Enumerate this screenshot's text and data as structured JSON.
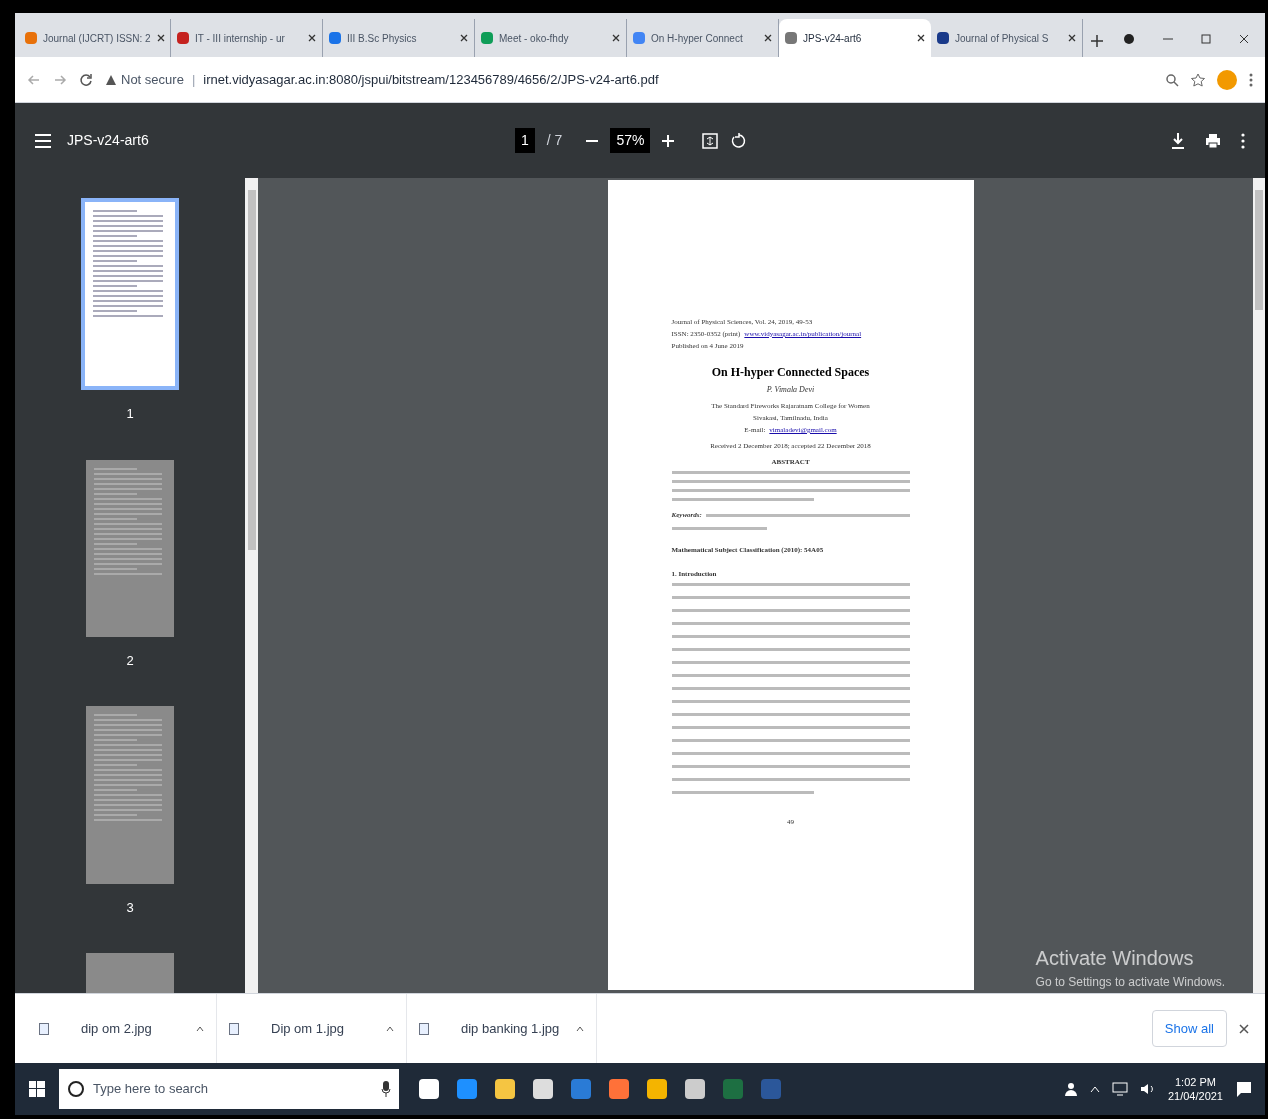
{
  "tabs": [
    {
      "title": "Journal (IJCRT) ISSN: 2",
      "selected": false
    },
    {
      "title": "IT - III internship - ur",
      "selected": false
    },
    {
      "title": "III B.Sc Physics",
      "selected": false
    },
    {
      "title": "Meet - oko-fhdy",
      "selected": false
    },
    {
      "title": "On H-hyper Connect",
      "selected": false
    },
    {
      "title": "JPS-v24-art6",
      "selected": true
    },
    {
      "title": "Journal of Physical S",
      "selected": false
    }
  ],
  "address_bar": {
    "security": "Not secure",
    "separator": "|",
    "url": "irnet.vidyasagar.ac.in:8080/jspui/bitstream/123456789/4656/2/JPS-v24-art6.pdf"
  },
  "pdf_toolbar": {
    "title": "JPS-v24-art6",
    "page": "1",
    "page_count": "/ 7",
    "zoom": "57%"
  },
  "thumbnails": [
    {
      "label": "1",
      "selected": true
    },
    {
      "label": "2",
      "selected": false
    },
    {
      "label": "3",
      "selected": false
    }
  ],
  "document": {
    "header": [
      "Journal of Physical Sciences, Vol. 24, 2019, 49-53",
      "ISSN: 2350-0352 (print)",
      "Published on 4 June 2019"
    ],
    "header_link": "www.vidyasagar.ac.in/publication/journal",
    "title": "On H-hyper Connected Spaces",
    "author": "P. Vimala Devi",
    "affiliation": [
      "The Standard Fireworks Rajaratnam College for Women",
      "Sivakasi, Tamilnadu, India"
    ],
    "email_label": "E-mail:",
    "email": "vimaladevi@gmail.com",
    "received": "Received 2 December 2018; accepted 22 December 2018",
    "abstract_heading": "ABSTRACT",
    "keywords_label": "Keywords:",
    "classification": "Mathematical Subject Classification (2010): 54A05",
    "section_heading": "1. Introduction",
    "page_number": "49"
  },
  "watermark_notice": {
    "title": "Activate Windows",
    "subtitle": "Go to Settings to activate Windows."
  },
  "downloads": [
    {
      "name": "dip om 2.jpg"
    },
    {
      "name": "Dip om 1.jpg"
    },
    {
      "name": "dip banking 1.jpg"
    }
  ],
  "downloads_show_all": "Show all",
  "taskbar": {
    "search_placeholder": "Type here to search",
    "time": "1:02 PM",
    "date": "21/04/2021"
  }
}
